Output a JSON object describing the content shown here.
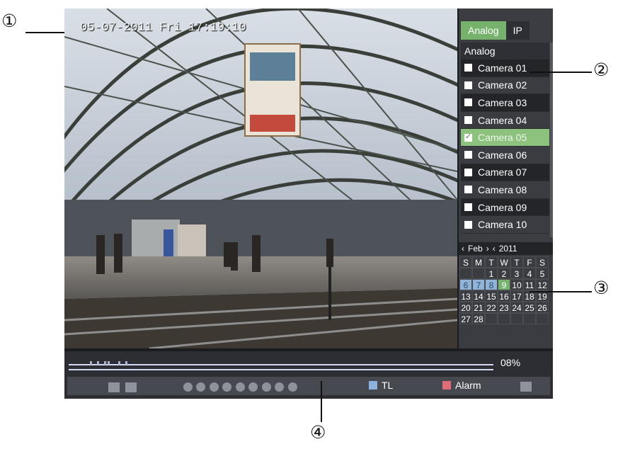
{
  "timestamp": "05-07-2011 Fri 17:19:10",
  "tabs": [
    {
      "label": "Analog",
      "active": true
    },
    {
      "label": "IP",
      "active": false
    }
  ],
  "camera_list": {
    "group_label": "Analog",
    "cameras": [
      {
        "label": "Camera 01",
        "checked": false
      },
      {
        "label": "Camera 02",
        "checked": false
      },
      {
        "label": "Camera 03",
        "checked": false
      },
      {
        "label": "Camera 04",
        "checked": false
      },
      {
        "label": "Camera 05",
        "checked": true
      },
      {
        "label": "Camera 06",
        "checked": false
      },
      {
        "label": "Camera 07",
        "checked": false
      },
      {
        "label": "Camera 08",
        "checked": false
      },
      {
        "label": "Camera 09",
        "checked": false
      },
      {
        "label": "Camera 10",
        "checked": false
      }
    ]
  },
  "calendar": {
    "month": "Feb",
    "year": "2011",
    "weekdays": [
      "S",
      "M",
      "T",
      "W",
      "T",
      "F",
      "S"
    ],
    "days": [
      [
        "",
        "",
        "1",
        "2",
        "3",
        "4",
        "5"
      ],
      [
        "6",
        "7",
        "8",
        "9",
        "10",
        "11",
        "12"
      ],
      [
        "13",
        "14",
        "15",
        "16",
        "17",
        "18",
        "19"
      ],
      [
        "20",
        "21",
        "22",
        "23",
        "24",
        "25",
        "26"
      ],
      [
        "27",
        "28",
        "",
        "",
        "",
        "",
        ""
      ]
    ],
    "highlighted_days": [
      "6",
      "7",
      "8"
    ],
    "selected_day": "9"
  },
  "playback": {
    "progress_label": "08%",
    "progress": 0.08
  },
  "controls": {
    "tl_label": "TL",
    "alarm_label": "Alarm",
    "tl_color": "#8db2de",
    "alarm_color": "#e06c78"
  },
  "callouts": [
    "①",
    "②",
    "③",
    "④"
  ],
  "colors": {
    "accent_green": "#77b26c",
    "panel_bg": "#3b3d43",
    "frame_bg": "#1a1c20"
  }
}
